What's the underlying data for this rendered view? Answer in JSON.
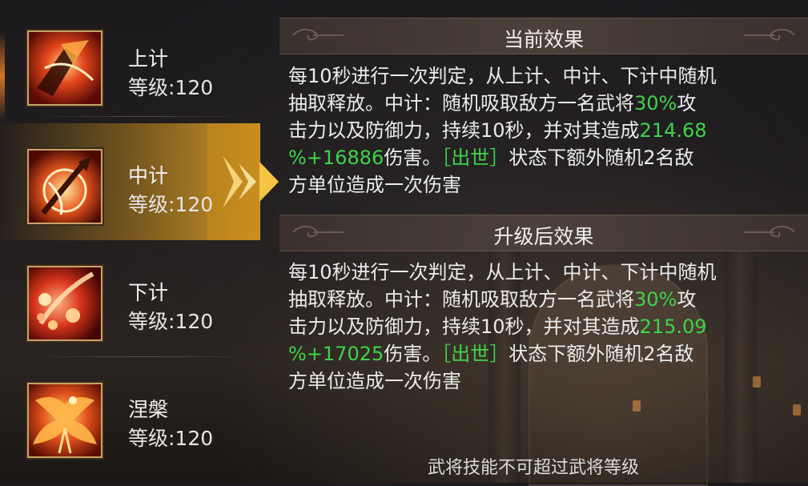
{
  "skills": [
    {
      "name": "上计",
      "level": "等级:120",
      "icon": "blade-slash-icon"
    },
    {
      "name": "中计",
      "level": "等级:120",
      "icon": "flaming-spear-icon"
    },
    {
      "name": "下计",
      "level": "等级:120",
      "icon": "fireballs-icon"
    },
    {
      "name": "涅槃",
      "level": "等级:120",
      "icon": "phoenix-icon"
    }
  ],
  "current": {
    "title": "当前效果",
    "lines": [
      [
        {
          "t": "每10秒进行一次判定，从上计、中计、下计中随机"
        }
      ],
      [
        {
          "t": "抽取释放。中计：随机吸取敌方一名武将"
        },
        {
          "t": "30%",
          "g": true
        },
        {
          "t": "攻"
        }
      ],
      [
        {
          "t": "击力以及防御力，持续10秒，并对其造成"
        },
        {
          "t": "214.68",
          "g": true
        }
      ],
      [
        {
          "t": "%+16886",
          "g": true
        },
        {
          "t": "伤害。"
        },
        {
          "t": "［出世］",
          "g": true
        },
        {
          "t": "状态下额外随机2名敌"
        }
      ],
      [
        {
          "t": "方单位造成一次伤害"
        }
      ]
    ]
  },
  "upgraded": {
    "title": "升级后效果",
    "lines": [
      [
        {
          "t": "每10秒进行一次判定，从上计、中计、下计中随机"
        }
      ],
      [
        {
          "t": "抽取释放。中计：随机吸取敌方一名武将"
        },
        {
          "t": "30%",
          "g": true
        },
        {
          "t": "攻"
        }
      ],
      [
        {
          "t": "击力以及防御力，持续10秒，并对其造成"
        },
        {
          "t": "215.09",
          "g": true
        }
      ],
      [
        {
          "t": "%+17025",
          "g": true
        },
        {
          "t": "伤害。"
        },
        {
          "t": "［出世］",
          "g": true
        },
        {
          "t": "状态下额外随机2名敌"
        }
      ],
      [
        {
          "t": "方单位造成一次伤害"
        }
      ]
    ]
  },
  "footer": "武将技能不可超过武将等级",
  "colors": {
    "highlight": "#3fd34a",
    "gold": "#e0a92e",
    "frame": "#c8a36a"
  },
  "selected_index": 1
}
